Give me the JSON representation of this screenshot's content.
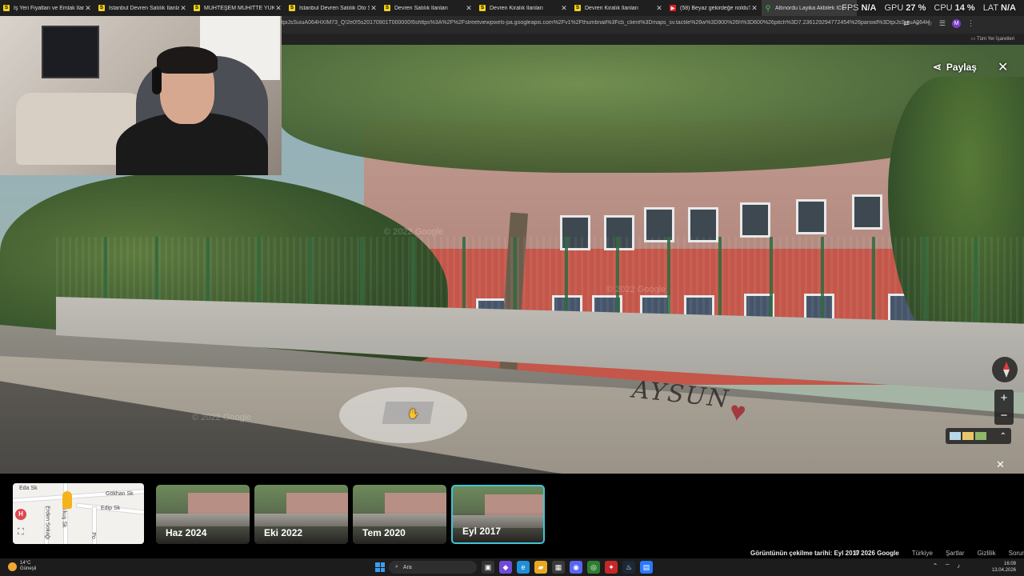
{
  "browser": {
    "tabs": [
      {
        "label": "İş Yeri Fiyatları ve Emlak İlanları",
        "icon": "sahibinden-icon",
        "color": "#f3d21a"
      },
      {
        "label": "İstanbul Devren Satılık İlanları",
        "icon": "sahibinden-icon",
        "color": "#f3d21a"
      },
      {
        "label": "MUHTEŞEM MUHİTTE YÜKSEK",
        "icon": "sahibinden-icon",
        "color": "#f3d21a"
      },
      {
        "label": "İstanbul Devren Satılık Oto Ser",
        "icon": "sahibinden-icon",
        "color": "#f3d21a"
      },
      {
        "label": "Devren Satılık İlanları",
        "icon": "sahibinden-icon",
        "color": "#f3d21a"
      },
      {
        "label": "Devren Kiralık İlanları",
        "icon": "sahibinden-icon",
        "color": "#f3d21a"
      },
      {
        "label": "Devren Kiralık İlanları",
        "icon": "sahibinden-icon",
        "color": "#f3d21a"
      },
      {
        "label": "(58) Beyaz gekirdeğe noldu? - Y",
        "icon": "youtube-icon",
        "color": "#e02020"
      },
      {
        "label": "Altınordu Layika Akbilek İOO",
        "icon": "maps-pin-icon",
        "color": "#34a853",
        "active": true
      }
    ],
    "tab_letter": "S",
    "url": "tpiJsSuiuA064HXIM73_Q!2e0!5s20170901T000000!6shttps%3A%2F%2Fstreetviewpixels-pa.googleapis.com%2Fv1%2Fthumbnail%3Fcb_client%3Dmaps_sv.tactile%26w%3D900%26h%3D600%26pitch%3D7.236129294772454%26panoid%3DtpiJsSuiuA064HXIM73_Q%...",
    "profile_initial": "M",
    "bookmarks_all": "Tüm Yer İşaretleri"
  },
  "hud": {
    "fps_label": "FPS",
    "fps_value": "N/A",
    "gpu_label": "GPU",
    "gpu_value": "27 %",
    "cpu_label": "CPU",
    "cpu_value": "14 %",
    "lat_label": "LAT",
    "lat_value": "N/A"
  },
  "streetview": {
    "share_label": "Paylaş",
    "watermark": "© 2022 Google",
    "graffiti": "AYSUN",
    "timeline": [
      {
        "label": "Haz 2024"
      },
      {
        "label": "Eki 2022"
      },
      {
        "label": "Tem 2020"
      },
      {
        "label": "Eyl 2017",
        "selected": true
      }
    ],
    "capture_date": "Görüntünün çekilme tarihi: Eyl 2017",
    "copyright": "© 2026 Google",
    "links": [
      "Türkiye",
      "Şartlar",
      "Gizlilik",
      "Sorun bildir"
    ]
  },
  "minimap": {
    "streets": [
      "Eda Sk",
      "Gökhan Sk",
      "Edip Sk",
      "Erkuş Sk",
      "Erden Sokağı",
      "Po"
    ],
    "hospital_marker": "H"
  },
  "taskbar": {
    "weather_temp": "14°C",
    "weather_desc": "Güneşli",
    "search_placeholder": "Ara",
    "time": "16:09",
    "date": "13.04.2026"
  },
  "colors": {
    "selected_thumb": "#40c4d6",
    "accent_blue": "#3c9bf0"
  }
}
